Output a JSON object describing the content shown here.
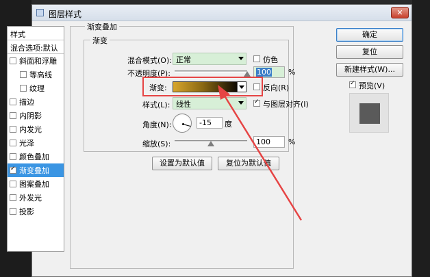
{
  "window": {
    "title": "图层样式",
    "close_label": "✕"
  },
  "left_panel": {
    "header": "样式",
    "blend_options": "混合选项:默认",
    "items": [
      {
        "label": "斜面和浮雕",
        "checked": false,
        "indent": false,
        "selected": false
      },
      {
        "label": "等高线",
        "checked": false,
        "indent": true,
        "selected": false
      },
      {
        "label": "纹理",
        "checked": false,
        "indent": true,
        "selected": false
      },
      {
        "label": "描边",
        "checked": false,
        "indent": false,
        "selected": false
      },
      {
        "label": "内阴影",
        "checked": false,
        "indent": false,
        "selected": false
      },
      {
        "label": "内发光",
        "checked": false,
        "indent": false,
        "selected": false
      },
      {
        "label": "光泽",
        "checked": false,
        "indent": false,
        "selected": false
      },
      {
        "label": "颜色叠加",
        "checked": false,
        "indent": false,
        "selected": false
      },
      {
        "label": "渐变叠加",
        "checked": true,
        "indent": false,
        "selected": true
      },
      {
        "label": "图案叠加",
        "checked": false,
        "indent": false,
        "selected": false
      },
      {
        "label": "外发光",
        "checked": false,
        "indent": false,
        "selected": false
      },
      {
        "label": "投影",
        "checked": false,
        "indent": false,
        "selected": false
      }
    ]
  },
  "gradient_overlay": {
    "group_title": "渐变叠加",
    "sub_title": "渐变",
    "blend_mode_label": "混合模式(O):",
    "blend_mode_value": "正常",
    "dither_label": "仿色",
    "opacity_label": "不透明度(P):",
    "opacity_value": "100",
    "opacity_unit": "%",
    "opacity_fraction": 1.0,
    "gradient_label": "渐变:",
    "reverse_label": "反向(R)",
    "style_label": "样式(L):",
    "style_value": "线性",
    "align_label": "与图层对齐(I)",
    "align_checked": true,
    "angle_label": "角度(N):",
    "angle_value": "-15",
    "angle_unit": "度",
    "scale_label": "缩放(S):",
    "scale_value": "100",
    "scale_unit": "%",
    "scale_fraction": 0.5,
    "set_default_label": "设置为默认值",
    "reset_default_label": "复位为默认值"
  },
  "right_panel": {
    "ok_label": "确定",
    "reset_label": "复位",
    "new_style_label": "新建样式(W)...",
    "preview_label": "预览(V)",
    "preview_checked": true
  },
  "colors": {
    "highlight": "#e64444",
    "selection": "#3a95e3",
    "gradient_start": "#d7a52c",
    "gradient_end": "#100b02"
  }
}
